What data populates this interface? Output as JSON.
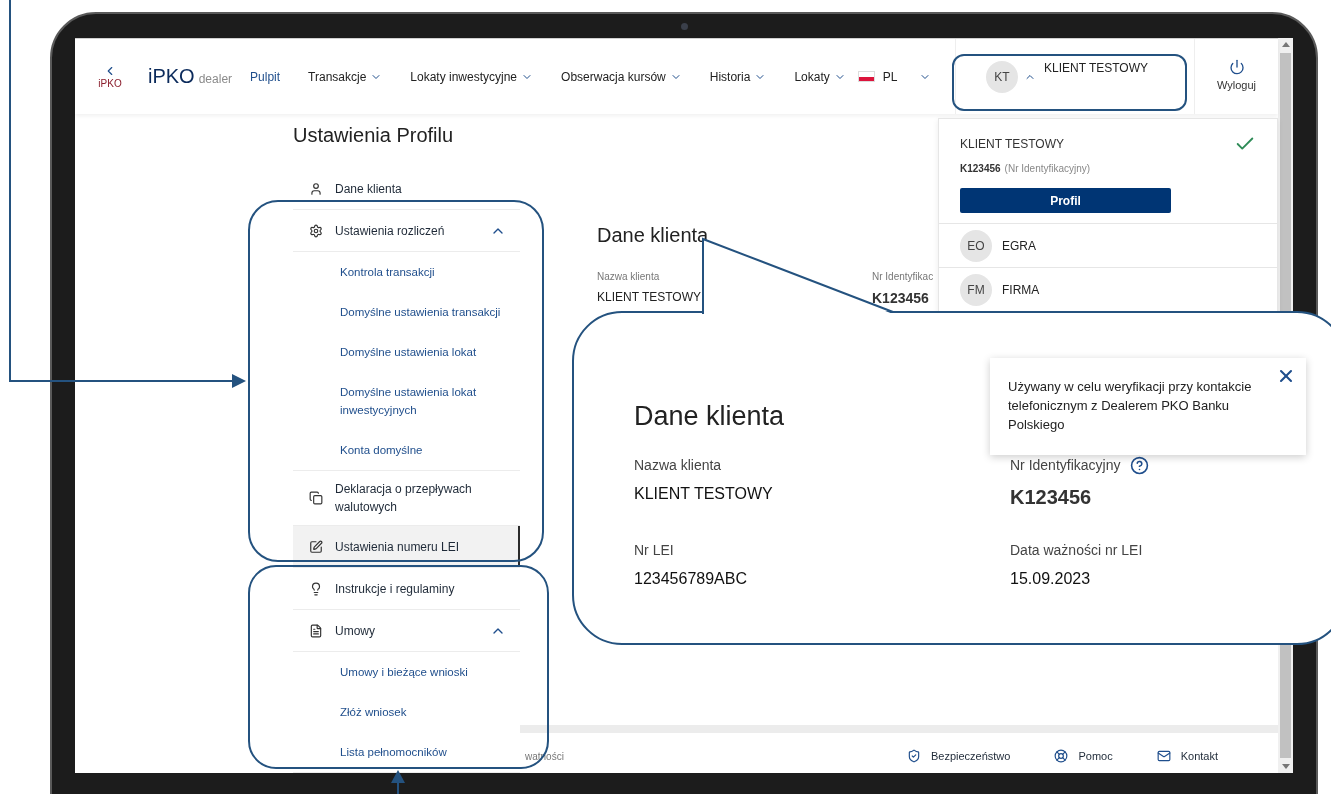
{
  "navbar": {
    "back_label": "iPKO",
    "logo": "iPKO",
    "logo_suffix": "dealer",
    "items": [
      {
        "label": "Pulpit",
        "kind": "link",
        "selected": true
      },
      {
        "label": "Transakcje",
        "kind": "menu",
        "selected": false
      },
      {
        "label": "Lokaty inwestycyjne",
        "kind": "menu",
        "selected": false
      },
      {
        "label": "Obserwacja kursów",
        "kind": "menu",
        "selected": false
      },
      {
        "label": "Historia",
        "kind": "menu",
        "selected": false
      },
      {
        "label": "Lokaty",
        "kind": "menu",
        "selected": false
      }
    ],
    "language": "PL",
    "account": {
      "initials": "KT",
      "name": "KLIENT TESTOWY",
      "expanded": true
    },
    "logout": "Wyloguj"
  },
  "page_title": "Ustawienia Profilu",
  "sidebar": {
    "items": [
      {
        "label": "Dane klienta",
        "selected": false
      },
      {
        "label": "Ustawienia rozliczeń",
        "selected": false,
        "expanded": true,
        "children": [
          {
            "label": "Kontrola transakcji",
            "selected": false
          },
          {
            "label": "Domyślne ustawienia transakcji",
            "selected": false
          },
          {
            "label": "Domyślne ustawienia lokat",
            "selected": false
          },
          {
            "label": "Domyślne ustawienia lokat inwestycyjnych",
            "selected": false
          },
          {
            "label": "Konta domyślne",
            "selected": false
          }
        ]
      },
      {
        "label": "Deklaracja o przepływach walutowych",
        "selected": false
      },
      {
        "label": "Ustawienia numeru LEI",
        "selected": true
      },
      {
        "label": "Instrukcje i regulaminy",
        "selected": false
      },
      {
        "label": "Umowy",
        "selected": false,
        "expanded": true,
        "children": [
          {
            "label": "Umowy i bieżące wnioski",
            "selected": false
          },
          {
            "label": "Złóż wniosek",
            "selected": false
          },
          {
            "label": "Lista pełnomocników",
            "selected": false
          }
        ]
      }
    ]
  },
  "content": {
    "heading": "Dane klienta",
    "fields": [
      {
        "label": "Nazwa klienta",
        "value": "KLIENT TESTOWY",
        "kind": "text"
      },
      {
        "label": "Nr Identyfikac",
        "value": "K123456",
        "kind": "id"
      }
    ]
  },
  "account_menu": {
    "current": {
      "name": "KLIENT TESTOWY",
      "id": "K123456",
      "id_note": "(Nr Identyfikacyjny)",
      "selected": true,
      "button": "Profil"
    },
    "others": [
      {
        "initials": "EO",
        "name": "EGRA",
        "selected": false
      },
      {
        "initials": "FM",
        "name": "FIRMA",
        "selected": false
      }
    ]
  },
  "footer": {
    "left_text": "watności",
    "links": [
      "Bezpieczeństwo",
      "Pomoc",
      "Kontakt"
    ]
  },
  "zoom_callout": {
    "heading": "Dane klienta",
    "fields": [
      {
        "label": "Nazwa klienta",
        "value": "KLIENT TESTOWY",
        "kind": "text"
      },
      {
        "label": "Nr Identyfikacyjny",
        "value": "K123456",
        "kind": "id"
      },
      {
        "label": "Nr LEI",
        "value": "123456789ABC",
        "kind": "text"
      },
      {
        "label": "Data ważności nr LEI",
        "value": "15.09.2023",
        "kind": "text"
      }
    ],
    "tooltip": "Używany w celu weryfikacji przy kontakcie telefonicznym z Dealerem PKO Banku Polskiego"
  }
}
